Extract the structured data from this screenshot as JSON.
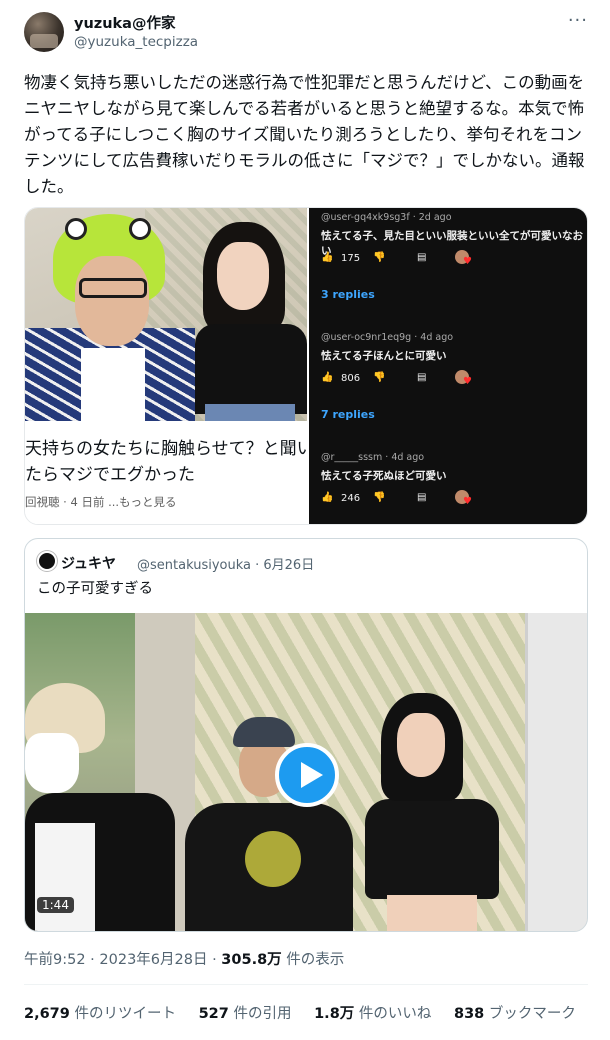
{
  "author": {
    "name": "yuzuka@作家",
    "handle": "@yuzuka_tecpizza"
  },
  "tweet": {
    "text": "物凄く気持ち悪いしただの迷惑行為で性犯罪だと思うんだけど、この動画をニヤニヤしながら見て楽しんでる若者がいると思うと絶望するな。本気で怖がってる子にしつこく胸のサイズ聞いたり測ろうとしたり、挙句それをコンテンツにして広告費稼いだりモラルの低さに「マジで？」でしかない。通報した。"
  },
  "media_left": {
    "caption_line1": "天持ちの女たちに胸触らせて？と聞い",
    "caption_line2": "たらマジでエグかった",
    "meta": "回視聴 · 4 日前  ...もっと見る"
  },
  "comments": [
    {
      "user": "@user-gq4xk9sg3f · 2d ago",
      "text": "怯えてる子、見た目といい服装といい全てが可愛いなおい",
      "likes": "175",
      "replies": "3 replies"
    },
    {
      "user": "@user-oc9nr1eq9g · 4d ago",
      "text": "怯えてる子ほんとに可愛い",
      "likes": "806",
      "replies": "7 replies"
    },
    {
      "user": "@r_____sssm · 4d ago",
      "text": "怯えてる子死ぬほど可愛い",
      "likes": "246",
      "replies": ""
    }
  ],
  "quote": {
    "name": "ジュキヤ",
    "handle_date": "@sentakusiyouka · 6月26日",
    "text": "この子可愛すぎる",
    "duration": "1:44"
  },
  "timestamp": {
    "time_date": "午前9:52 · 2023年6月28日 · ",
    "views": "305.8万",
    "views_label": " 件の表示"
  },
  "stats": {
    "retweets": "2,679",
    "retweets_label": " 件のリツイート",
    "quotes": "527",
    "quotes_label": " 件の引用",
    "likes": "1.8万",
    "likes_label": " 件のいいね",
    "bookmarks": "838",
    "bookmarks_label": " ブックマーク"
  },
  "colors": {
    "accent": "#1d9bf0",
    "secondary_text": "#536471",
    "reply_link": "#3ea6ff"
  }
}
